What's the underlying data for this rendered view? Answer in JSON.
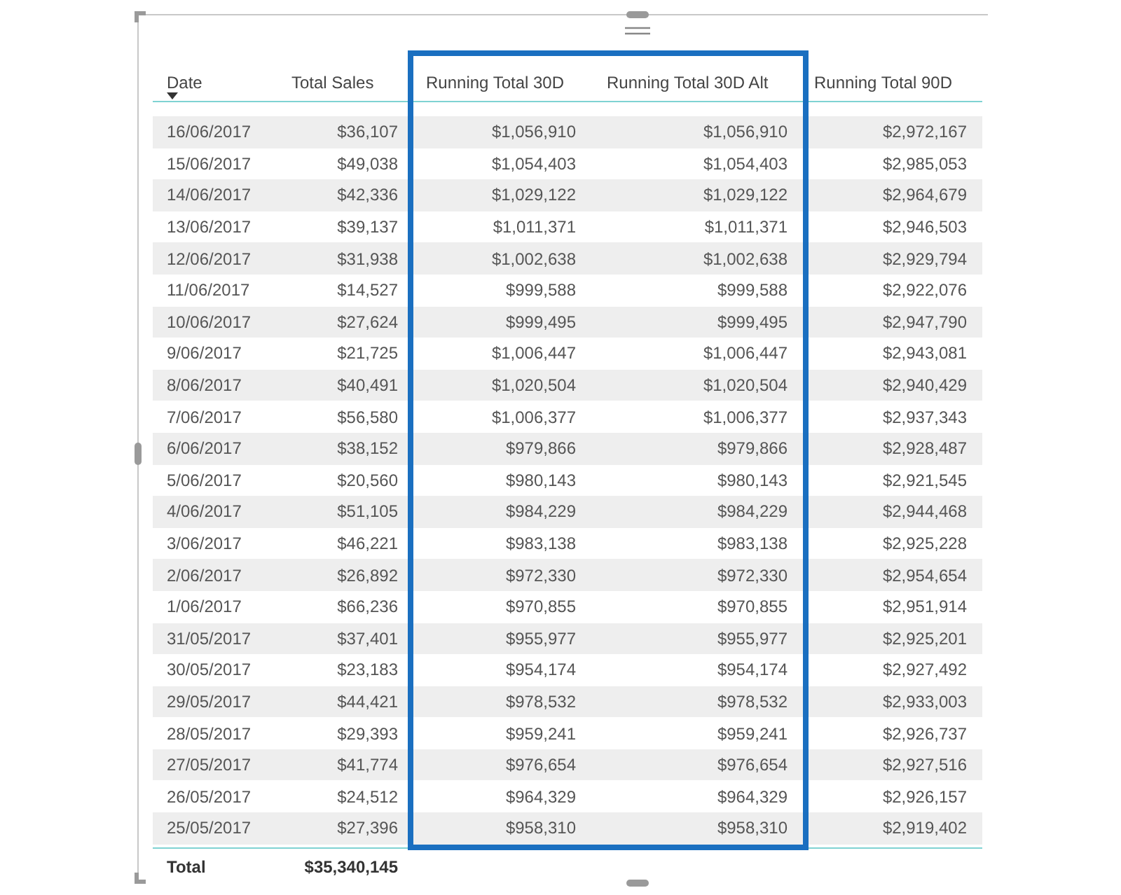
{
  "table": {
    "columns": [
      {
        "label": "Date",
        "sorted": true
      },
      {
        "label": "Total Sales",
        "sorted": false
      },
      {
        "label": "Running Total 30D",
        "sorted": false
      },
      {
        "label": "Running Total 30D Alt",
        "sorted": false
      },
      {
        "label": "Running Total 90D",
        "sorted": false
      }
    ],
    "rows": [
      [
        "16/06/2017",
        "$36,107",
        "$1,056,910",
        "$1,056,910",
        "$2,972,167"
      ],
      [
        "15/06/2017",
        "$49,038",
        "$1,054,403",
        "$1,054,403",
        "$2,985,053"
      ],
      [
        "14/06/2017",
        "$42,336",
        "$1,029,122",
        "$1,029,122",
        "$2,964,679"
      ],
      [
        "13/06/2017",
        "$39,137",
        "$1,011,371",
        "$1,011,371",
        "$2,946,503"
      ],
      [
        "12/06/2017",
        "$31,938",
        "$1,002,638",
        "$1,002,638",
        "$2,929,794"
      ],
      [
        "11/06/2017",
        "$14,527",
        "$999,588",
        "$999,588",
        "$2,922,076"
      ],
      [
        "10/06/2017",
        "$27,624",
        "$999,495",
        "$999,495",
        "$2,947,790"
      ],
      [
        "9/06/2017",
        "$21,725",
        "$1,006,447",
        "$1,006,447",
        "$2,943,081"
      ],
      [
        "8/06/2017",
        "$40,491",
        "$1,020,504",
        "$1,020,504",
        "$2,940,429"
      ],
      [
        "7/06/2017",
        "$56,580",
        "$1,006,377",
        "$1,006,377",
        "$2,937,343"
      ],
      [
        "6/06/2017",
        "$38,152",
        "$979,866",
        "$979,866",
        "$2,928,487"
      ],
      [
        "5/06/2017",
        "$20,560",
        "$980,143",
        "$980,143",
        "$2,921,545"
      ],
      [
        "4/06/2017",
        "$51,105",
        "$984,229",
        "$984,229",
        "$2,944,468"
      ],
      [
        "3/06/2017",
        "$46,221",
        "$983,138",
        "$983,138",
        "$2,925,228"
      ],
      [
        "2/06/2017",
        "$26,892",
        "$972,330",
        "$972,330",
        "$2,954,654"
      ],
      [
        "1/06/2017",
        "$66,236",
        "$970,855",
        "$970,855",
        "$2,951,914"
      ],
      [
        "31/05/2017",
        "$37,401",
        "$955,977",
        "$955,977",
        "$2,925,201"
      ],
      [
        "30/05/2017",
        "$23,183",
        "$954,174",
        "$954,174",
        "$2,927,492"
      ],
      [
        "29/05/2017",
        "$44,421",
        "$978,532",
        "$978,532",
        "$2,933,003"
      ],
      [
        "28/05/2017",
        "$29,393",
        "$959,241",
        "$959,241",
        "$2,926,737"
      ],
      [
        "27/05/2017",
        "$41,774",
        "$976,654",
        "$976,654",
        "$2,927,516"
      ],
      [
        "26/05/2017",
        "$24,512",
        "$964,329",
        "$964,329",
        "$2,926,157"
      ],
      [
        "25/05/2017",
        "$27,396",
        "$958,310",
        "$958,310",
        "$2,919,402"
      ]
    ],
    "total": [
      "Total",
      "$35,340,145"
    ]
  }
}
